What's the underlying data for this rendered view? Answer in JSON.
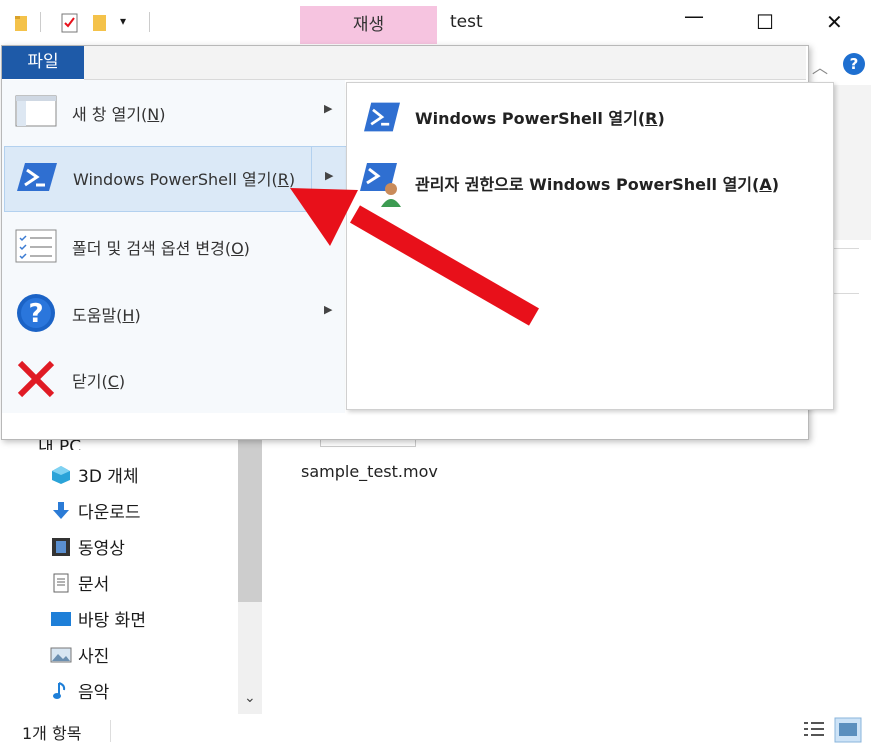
{
  "window": {
    "title": "test",
    "contextual_tab": "재생",
    "minimize": "—",
    "maximize": "☐",
    "close": "✕"
  },
  "menu": {
    "file_tab": "파일",
    "items": [
      {
        "label": "새 창 열기(",
        "key": "N",
        "tail": ")",
        "has_submenu": true,
        "icon": "new-window-icon"
      },
      {
        "label": "Windows PowerShell 열기(",
        "key": "R",
        "tail": ")",
        "has_submenu": true,
        "icon": "powershell-icon",
        "selected": true
      },
      {
        "label": "폴더 및 검색 옵션 변경(",
        "key": "O",
        "tail": ")",
        "has_submenu": false,
        "icon": "folder-options-icon"
      },
      {
        "label": "도움말(",
        "key": "H",
        "tail": ")",
        "has_submenu": true,
        "icon": "help-icon"
      },
      {
        "label": "닫기(",
        "key": "C",
        "tail": ")",
        "has_submenu": false,
        "icon": "close-x-icon"
      }
    ],
    "submenu": [
      {
        "label": "Windows PowerShell 열기(",
        "key": "R",
        "tail": ")",
        "icon": "powershell-icon"
      },
      {
        "label": "관리자 권한으로 Windows PowerShell 열기(",
        "key": "A",
        "tail": ")",
        "icon": "powershell-admin-icon"
      }
    ]
  },
  "explorer": {
    "help": "?",
    "nav_partial": "내 PC",
    "nav": [
      {
        "label": "3D 개체",
        "icon": "3d-objects-icon"
      },
      {
        "label": "다운로드",
        "icon": "downloads-icon"
      },
      {
        "label": "동영상",
        "icon": "videos-icon"
      },
      {
        "label": "문서",
        "icon": "documents-icon"
      },
      {
        "label": "바탕 화면",
        "icon": "desktop-icon"
      },
      {
        "label": "사진",
        "icon": "pictures-icon"
      },
      {
        "label": "음악",
        "icon": "music-icon"
      }
    ],
    "file_name": "sample_test.mov",
    "status": "1개 항목"
  },
  "colors": {
    "file_tab": "#1e5aa8",
    "contextual_tab": "#f6c4e0",
    "highlight": "#dbe9f7",
    "arrow": "#e8101a"
  }
}
